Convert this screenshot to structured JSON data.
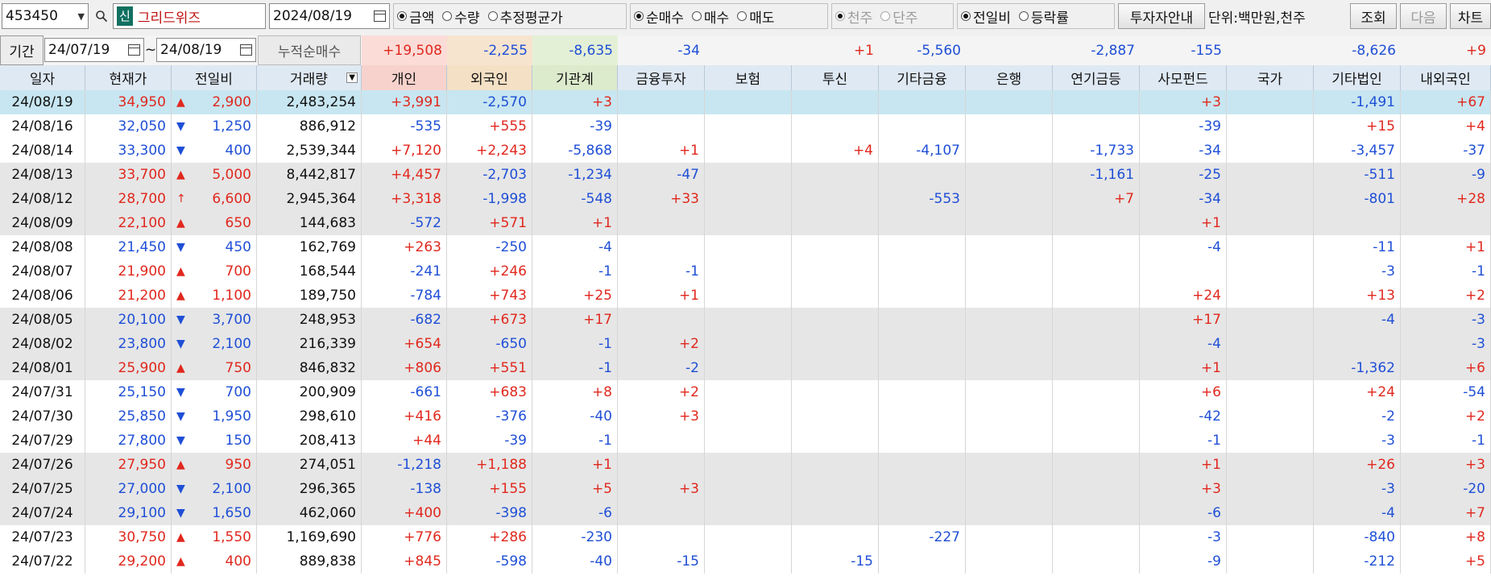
{
  "toolbar": {
    "code": "453450",
    "badge": "신",
    "stock_name": "그리드위즈",
    "date": "2024/08/19",
    "value_options": [
      "금액",
      "수량",
      "추정평균가"
    ],
    "trade_options": [
      "순매수",
      "매수",
      "매도"
    ],
    "unit_options": [
      "천주",
      "단주"
    ],
    "compare_options": [
      "전일비",
      "등락률"
    ],
    "investor_info_label": "투자자안내",
    "unit_label": "단위:백만원,천주",
    "query_label": "조회",
    "next_label": "다음",
    "chart_label": "차트"
  },
  "period": {
    "label": "기간",
    "start": "24/07/19",
    "tilde": "~",
    "end": "24/08/19",
    "sum_label": "누적순매수",
    "sums": [
      "+19,508",
      "-2,255",
      "-8,635",
      "-34",
      "",
      "+1",
      "-5,560",
      "",
      "-2,887",
      "-155",
      "",
      "-8,626",
      "+9"
    ]
  },
  "columns": [
    "일자",
    "현재가",
    "전일비",
    "거래량",
    "개인",
    "외국인",
    "기관계",
    "금융투자",
    "보험",
    "투신",
    "기타금융",
    "은행",
    "연기금등",
    "사모펀드",
    "국가",
    "기타법인",
    "내외국인"
  ],
  "rows": [
    {
      "date": "24/08/19",
      "price": "34,950",
      "arrow": "▲",
      "chg": "2,900",
      "vol": "2,483,254",
      "v": [
        "+3,991",
        "-2,570",
        "+3",
        "",
        "",
        "",
        "",
        "",
        "",
        "+3",
        "",
        "-1,491",
        "+67"
      ]
    },
    {
      "date": "24/08/16",
      "price": "32,050",
      "arrow": "▼",
      "chg": "1,250",
      "vol": "886,912",
      "v": [
        "-535",
        "+555",
        "-39",
        "",
        "",
        "",
        "",
        "",
        "",
        "-39",
        "",
        "+15",
        "+4"
      ]
    },
    {
      "date": "24/08/14",
      "price": "33,300",
      "arrow": "▼",
      "chg": "400",
      "vol": "2,539,344",
      "v": [
        "+7,120",
        "+2,243",
        "-5,868",
        "+1",
        "",
        "+4",
        "-4,107",
        "",
        "-1,733",
        "-34",
        "",
        "-3,457",
        "-37"
      ]
    },
    {
      "date": "24/08/13",
      "price": "33,700",
      "arrow": "▲",
      "chg": "5,000",
      "vol": "8,442,817",
      "v": [
        "+4,457",
        "-2,703",
        "-1,234",
        "-47",
        "",
        "",
        "",
        "",
        "-1,161",
        "-25",
        "",
        "-511",
        "-9"
      ]
    },
    {
      "date": "24/08/12",
      "price": "28,700",
      "arrow": "↑",
      "chg": "6,600",
      "vol": "2,945,364",
      "v": [
        "+3,318",
        "-1,998",
        "-548",
        "+33",
        "",
        "",
        "-553",
        "",
        "+7",
        "-34",
        "",
        "-801",
        "+28"
      ]
    },
    {
      "date": "24/08/09",
      "price": "22,100",
      "arrow": "▲",
      "chg": "650",
      "vol": "144,683",
      "v": [
        "-572",
        "+571",
        "+1",
        "",
        "",
        "",
        "",
        "",
        "",
        "+1",
        "",
        "",
        ""
      ]
    },
    {
      "date": "24/08/08",
      "price": "21,450",
      "arrow": "▼",
      "chg": "450",
      "vol": "162,769",
      "v": [
        "+263",
        "-250",
        "-4",
        "",
        "",
        "",
        "",
        "",
        "",
        "-4",
        "",
        "-11",
        "+1"
      ]
    },
    {
      "date": "24/08/07",
      "price": "21,900",
      "arrow": "▲",
      "chg": "700",
      "vol": "168,544",
      "v": [
        "-241",
        "+246",
        "-1",
        "-1",
        "",
        "",
        "",
        "",
        "",
        "",
        "",
        "-3",
        "-1"
      ]
    },
    {
      "date": "24/08/06",
      "price": "21,200",
      "arrow": "▲",
      "chg": "1,100",
      "vol": "189,750",
      "v": [
        "-784",
        "+743",
        "+25",
        "+1",
        "",
        "",
        "",
        "",
        "",
        "+24",
        "",
        "+13",
        "+2"
      ]
    },
    {
      "date": "24/08/05",
      "price": "20,100",
      "arrow": "▼",
      "chg": "3,700",
      "vol": "248,953",
      "v": [
        "-682",
        "+673",
        "+17",
        "",
        "",
        "",
        "",
        "",
        "",
        "+17",
        "",
        "-4",
        "-3"
      ]
    },
    {
      "date": "24/08/02",
      "price": "23,800",
      "arrow": "▼",
      "chg": "2,100",
      "vol": "216,339",
      "v": [
        "+654",
        "-650",
        "-1",
        "+2",
        "",
        "",
        "",
        "",
        "",
        "-4",
        "",
        "",
        "-3"
      ]
    },
    {
      "date": "24/08/01",
      "price": "25,900",
      "arrow": "▲",
      "chg": "750",
      "vol": "846,832",
      "v": [
        "+806",
        "+551",
        "-1",
        "-2",
        "",
        "",
        "",
        "",
        "",
        "+1",
        "",
        "-1,362",
        "+6"
      ]
    },
    {
      "date": "24/07/31",
      "price": "25,150",
      "arrow": "▼",
      "chg": "700",
      "vol": "200,909",
      "v": [
        "-661",
        "+683",
        "+8",
        "+2",
        "",
        "",
        "",
        "",
        "",
        "+6",
        "",
        "+24",
        "-54"
      ]
    },
    {
      "date": "24/07/30",
      "price": "25,850",
      "arrow": "▼",
      "chg": "1,950",
      "vol": "298,610",
      "v": [
        "+416",
        "-376",
        "-40",
        "+3",
        "",
        "",
        "",
        "",
        "",
        "-42",
        "",
        "-2",
        "+2"
      ]
    },
    {
      "date": "24/07/29",
      "price": "27,800",
      "arrow": "▼",
      "chg": "150",
      "vol": "208,413",
      "v": [
        "+44",
        "-39",
        "-1",
        "",
        "",
        "",
        "",
        "",
        "",
        "-1",
        "",
        "-3",
        "-1"
      ]
    },
    {
      "date": "24/07/26",
      "price": "27,950",
      "arrow": "▲",
      "chg": "950",
      "vol": "274,051",
      "v": [
        "-1,218",
        "+1,188",
        "+1",
        "",
        "",
        "",
        "",
        "",
        "",
        "+1",
        "",
        "+26",
        "+3"
      ]
    },
    {
      "date": "24/07/25",
      "price": "27,000",
      "arrow": "▼",
      "chg": "2,100",
      "vol": "296,365",
      "v": [
        "-138",
        "+155",
        "+5",
        "+3",
        "",
        "",
        "",
        "",
        "",
        "+3",
        "",
        "-3",
        "-20"
      ]
    },
    {
      "date": "24/07/24",
      "price": "29,100",
      "arrow": "▼",
      "chg": "1,650",
      "vol": "462,060",
      "v": [
        "+400",
        "-398",
        "-6",
        "",
        "",
        "",
        "",
        "",
        "",
        "-6",
        "",
        "-4",
        "+7"
      ]
    },
    {
      "date": "24/07/23",
      "price": "30,750",
      "arrow": "▲",
      "chg": "1,550",
      "vol": "1,169,690",
      "v": [
        "+776",
        "+286",
        "-230",
        "",
        "",
        "",
        "-227",
        "",
        "",
        "-3",
        "",
        "-840",
        "+8"
      ]
    },
    {
      "date": "24/07/22",
      "price": "29,200",
      "arrow": "▲",
      "chg": "400",
      "vol": "889,838",
      "v": [
        "+845",
        "-598",
        "-40",
        "-15",
        "",
        "-15",
        "",
        "",
        "",
        "-9",
        "",
        "-212",
        "+5"
      ]
    }
  ],
  "colors": {
    "up": "#e0281e",
    "down": "#1f4fd6",
    "selected_row": "#c7e6f1",
    "gray_row": "#e6e6e6",
    "header": "#dfe9f3"
  }
}
